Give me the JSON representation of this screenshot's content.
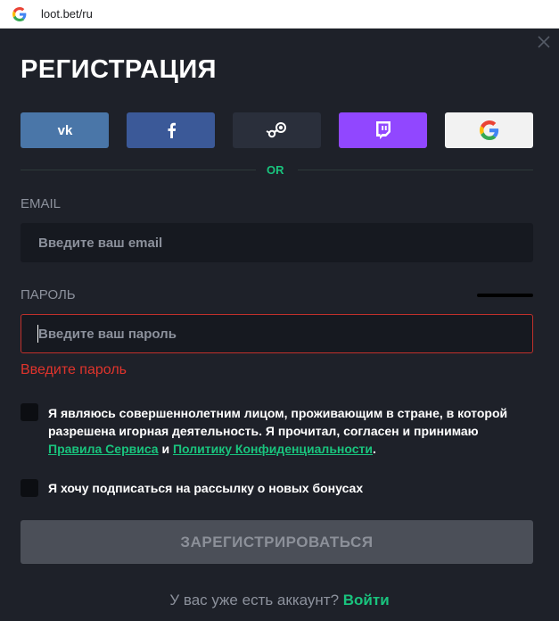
{
  "browser": {
    "url": "loot.bet/ru",
    "favicon": "google-g-icon"
  },
  "modal": {
    "title": "РЕГИСТРАЦИЯ",
    "close_icon": "close-icon",
    "social_buttons": [
      {
        "name": "vk",
        "icon": "vk-icon",
        "color": "#4a76a8"
      },
      {
        "name": "facebook",
        "icon": "facebook-icon",
        "color": "#3b5998"
      },
      {
        "name": "steam",
        "icon": "steam-icon",
        "color": "#2a2f3b"
      },
      {
        "name": "twitch",
        "icon": "twitch-icon",
        "color": "#9147ff"
      },
      {
        "name": "google",
        "icon": "google-icon",
        "color": "#f2f2f2"
      }
    ],
    "divider_text": "OR",
    "email": {
      "label": "EMAIL",
      "placeholder": "Введите ваш email",
      "value": ""
    },
    "password": {
      "label": "ПАРОЛЬ",
      "placeholder": "Введите ваш пароль",
      "value": "",
      "error": "Введите пароль"
    },
    "agree_checkbox": {
      "checked": false,
      "text_before": "Я являюсь совершеннолетним лицом, проживающим в стране, в которой разрешена игорная деятельность. Я прочитал, согласен и принимаю ",
      "link_terms": "Правила Сервиса",
      "text_and": " и ",
      "link_privacy": "Политику Конфиденциальности",
      "text_after": "."
    },
    "newsletter_checkbox": {
      "checked": false,
      "text": "Я хочу подписаться на рассылку о новых бонусах"
    },
    "submit_label": "ЗАРЕГИСТРИРОВАТЬСЯ",
    "footer": {
      "question": "У вас уже есть аккаунт?",
      "login_link": "Войти"
    }
  },
  "colors": {
    "background": "#1e2129",
    "input_bg": "#161920",
    "accent_green": "#19c37d",
    "error_red": "#e0342c",
    "submit_disabled": "#4b4f58"
  }
}
